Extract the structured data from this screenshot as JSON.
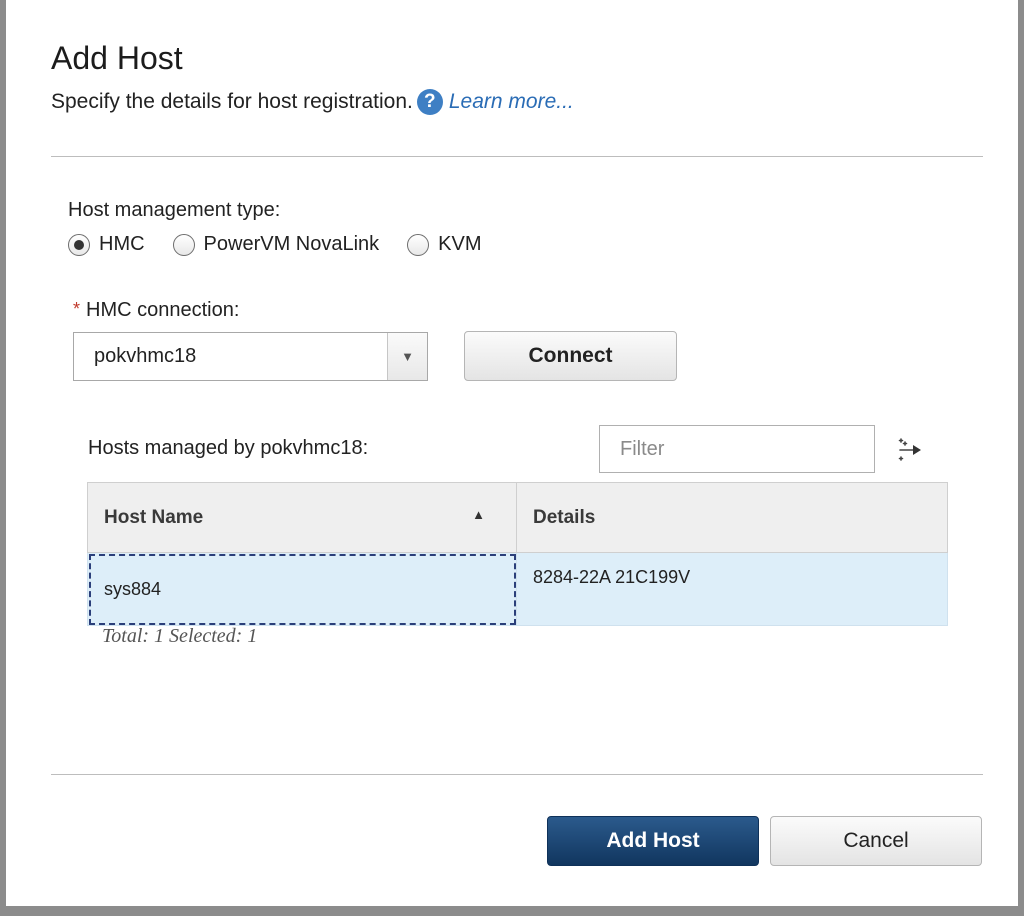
{
  "dialog": {
    "title": "Add Host",
    "subtitle": "Specify the details for host registration.",
    "help_icon_glyph": "?",
    "learn_more": "Learn more..."
  },
  "host_management": {
    "label": "Host management type:",
    "options": [
      "HMC",
      "PowerVM NovaLink",
      "KVM"
    ],
    "selected": "HMC"
  },
  "hmc_connection": {
    "required_marker": "*",
    "label": "HMC connection:",
    "value": "pokvhmc18",
    "arrow_glyph": "▼",
    "connect_label": "Connect"
  },
  "hosts": {
    "label": "Hosts managed by pokvhmc18:",
    "filter_placeholder": "Filter",
    "columns": [
      "Host Name",
      "Details"
    ],
    "sort_glyph": "▲",
    "rows": [
      {
        "host_name": "sys884",
        "details": "8284-22A 21C199V",
        "selected": true
      }
    ],
    "summary": "Total: 1 Selected: 1"
  },
  "footer": {
    "primary_label": "Add Host",
    "cancel_label": "Cancel"
  },
  "colors": {
    "primary_button": "#1b4470",
    "selected_row": "#ddeef9",
    "link": "#2a6cb5",
    "required": "#c0392b"
  },
  "icons": {
    "help": "help-circle-icon",
    "dropdown": "chevron-down-icon",
    "filter": "filter-toggle-icon",
    "sort": "sort-ascending-icon"
  }
}
